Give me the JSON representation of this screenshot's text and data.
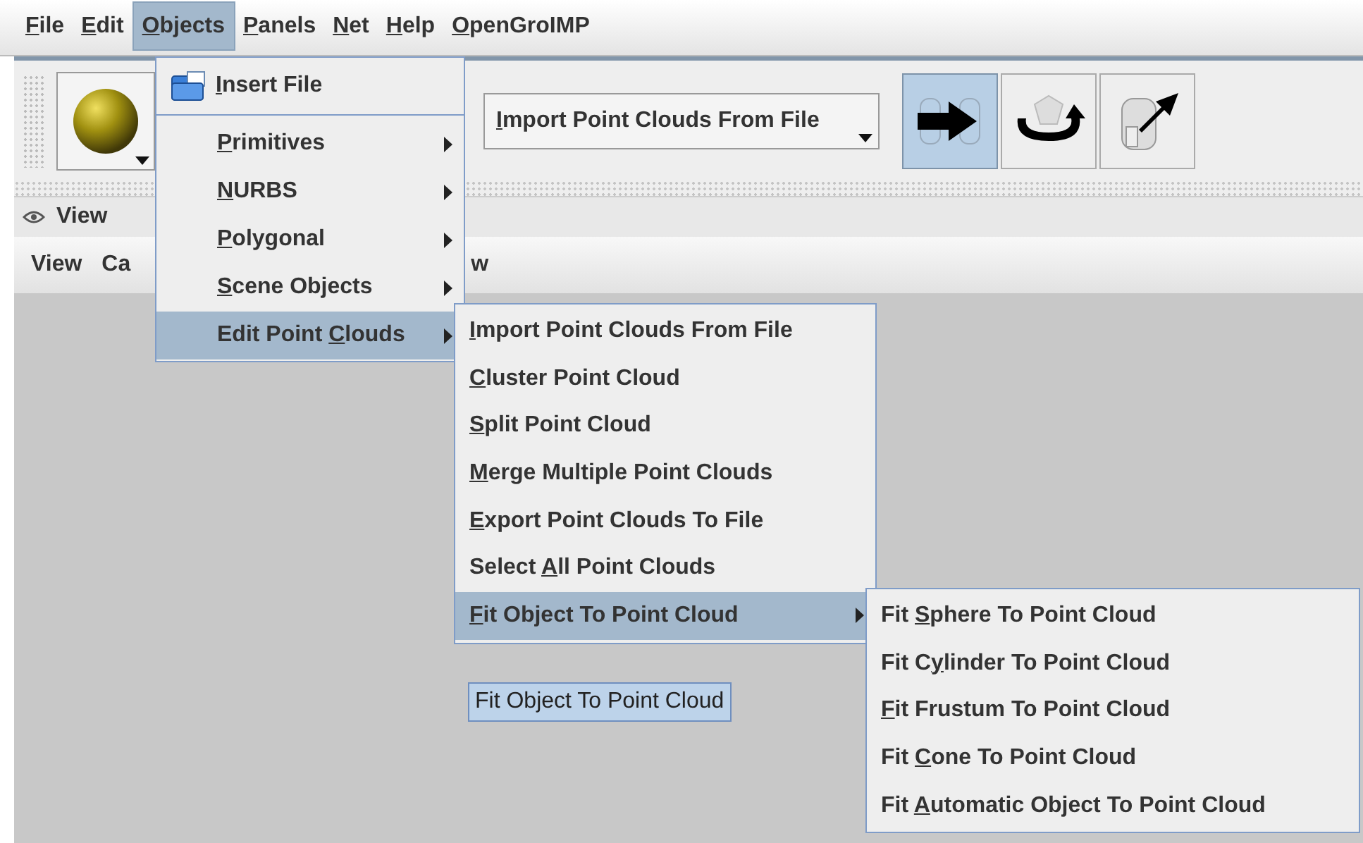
{
  "menubar": [
    {
      "key": "F",
      "post": "ile",
      "selected": false
    },
    {
      "key": "E",
      "post": "dit",
      "selected": false
    },
    {
      "key": "O",
      "post": "bjects",
      "selected": true
    },
    {
      "key": "P",
      "post": "anels",
      "selected": false
    },
    {
      "key": "N",
      "post": "et",
      "selected": false
    },
    {
      "key": "H",
      "post": "elp",
      "selected": false
    },
    {
      "key": "O",
      "post": "penGroIMP",
      "selected": false
    }
  ],
  "toolbar": {
    "combo": {
      "key": "I",
      "post": "mport Point Clouds From File"
    },
    "tool_buttons": [
      {
        "kind": "transfer",
        "selected": true
      },
      {
        "kind": "rotate",
        "selected": false
      },
      {
        "kind": "extract",
        "selected": false
      }
    ]
  },
  "view_panel": {
    "title": "View",
    "menus": [
      "View",
      "Ca",
      "w"
    ],
    "label": "Fit Object To Point Cloud"
  },
  "objects_menu": [
    {
      "kind": "icon",
      "key": "I",
      "post": "nsert File",
      "submenu": false,
      "selected": false
    },
    {
      "kind": "separator"
    },
    {
      "kind": "item",
      "key": "P",
      "post": "rimitives",
      "submenu": true,
      "selected": false
    },
    {
      "kind": "item",
      "key": "N",
      "post": "URBS",
      "submenu": true,
      "selected": false
    },
    {
      "kind": "item",
      "key": "P",
      "post": "olygonal",
      "submenu": true,
      "selected": false
    },
    {
      "kind": "item",
      "key": "S",
      "post": "cene Objects",
      "submenu": true,
      "selected": false
    },
    {
      "kind": "item",
      "pre": "Edit Point ",
      "key": "C",
      "post": "louds",
      "submenu": true,
      "selected": true
    }
  ],
  "point_clouds_menu": [
    {
      "key": "I",
      "post": "mport Point Clouds From File",
      "submenu": false,
      "selected": false
    },
    {
      "key": "C",
      "post": "luster Point Cloud",
      "submenu": false,
      "selected": false
    },
    {
      "key": "S",
      "post": "plit Point Cloud",
      "submenu": false,
      "selected": false
    },
    {
      "key": "M",
      "post": "erge Multiple Point Clouds",
      "submenu": false,
      "selected": false
    },
    {
      "key": "E",
      "post": "xport Point Clouds To File",
      "submenu": false,
      "selected": false
    },
    {
      "pre": "Select ",
      "key": "A",
      "post": "ll Point Clouds",
      "submenu": false,
      "selected": false
    },
    {
      "key": "F",
      "post": "it Object To Point Cloud",
      "submenu": true,
      "selected": true
    }
  ],
  "fit_menu": [
    {
      "pre": "Fit ",
      "key": "S",
      "post": "phere To Point Cloud",
      "submenu": false,
      "selected": false
    },
    {
      "pre": "Fit C",
      "key": "y",
      "post": "linder To Point Cloud",
      "submenu": false,
      "selected": false
    },
    {
      "key": "F",
      "post": "it Frustum To Point Cloud",
      "submenu": false,
      "selected": false
    },
    {
      "pre": "Fit ",
      "key": "C",
      "post": "one To Point Cloud",
      "submenu": false,
      "selected": false
    },
    {
      "pre": "Fit ",
      "key": "A",
      "post": "utomatic Object To Point Cloud",
      "submenu": false,
      "selected": false
    }
  ]
}
